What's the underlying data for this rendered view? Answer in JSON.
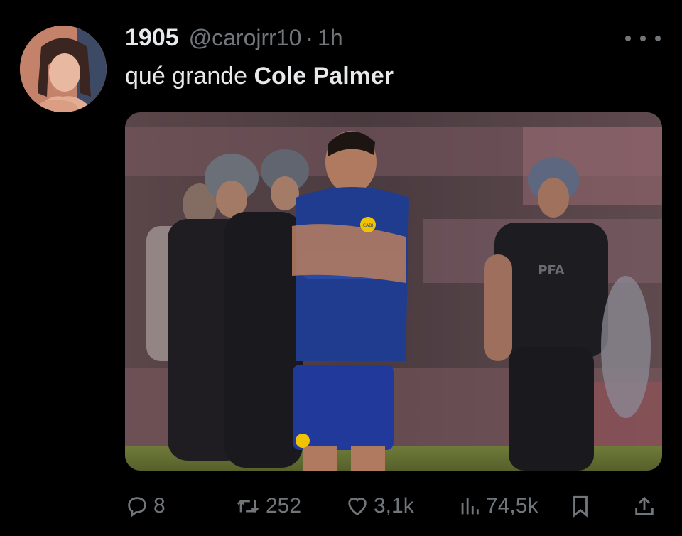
{
  "tweet": {
    "display_name": "1905",
    "handle": "@carojrr10",
    "separator": "·",
    "time": "1h",
    "text_prefix": "qué grande ",
    "text_bold": "Cole Palmer"
  },
  "media": {
    "jersey_badge": "CABJ",
    "police_badge": "PFA"
  },
  "actions": {
    "replies": "8",
    "retweets": "252",
    "likes": "3,1k",
    "views": "74,5k"
  },
  "icons": {
    "more": "more-horizontal-icon",
    "reply": "reply-icon",
    "retweet": "retweet-icon",
    "like": "heart-icon",
    "views": "views-icon",
    "bookmark": "bookmark-icon",
    "share": "share-icon"
  },
  "colors": {
    "background": "#000000",
    "text_primary": "#e7e9ea",
    "text_secondary": "#71767b"
  }
}
